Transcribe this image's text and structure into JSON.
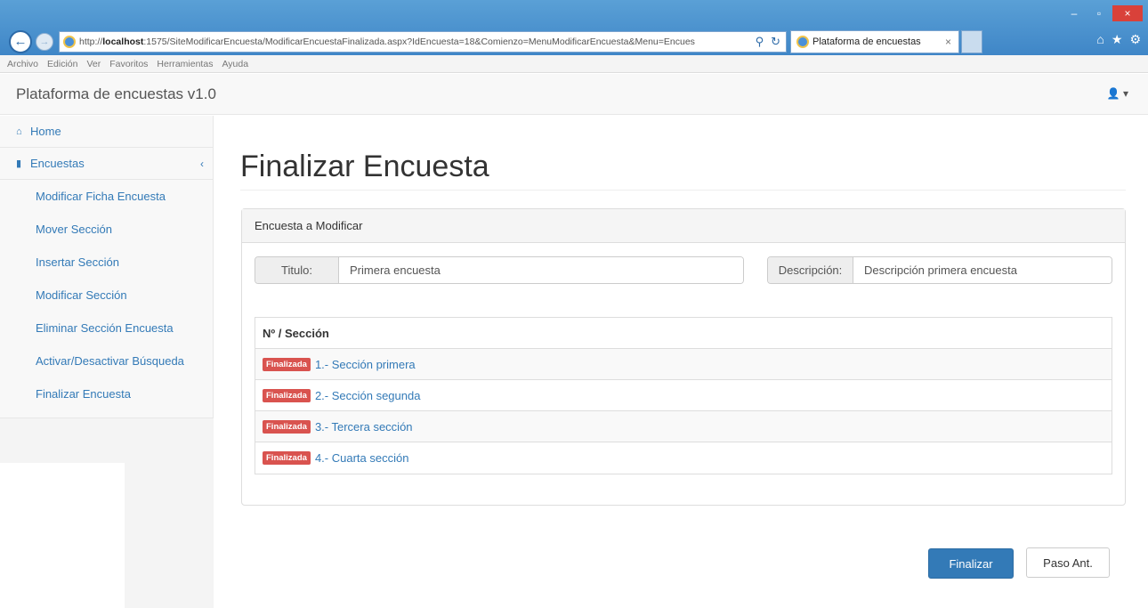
{
  "browser": {
    "url_prefix": "http://",
    "url_host": "localhost",
    "url_rest": ":1575/SiteModificarEncuesta/ModificarEncuestaFinalizada.aspx?IdEncuesta=18&Comienzo=MenuModificarEncuesta&Menu=Encues",
    "search_glyph": "⚲",
    "refresh_glyph": "↻",
    "tab_title": "Plataforma de encuestas",
    "tab_close": "×",
    "window_minimize": "–",
    "window_maximize": "▫",
    "window_close": "×",
    "home_glyph": "⌂",
    "star_glyph": "★",
    "gear_glyph": "⚙",
    "back_glyph": "←",
    "forward_glyph": "→",
    "menu": [
      "Archivo",
      "Edición",
      "Ver",
      "Favoritos",
      "Herramientas",
      "Ayuda"
    ]
  },
  "navbar": {
    "brand": "Plataforma de encuestas v1.0",
    "user_glyph": "👤 ▾"
  },
  "sidebar": {
    "home": "Home",
    "home_glyph": "⌂",
    "encuestas": "Encuestas",
    "encuestas_glyph": "▮",
    "chevron": "‹",
    "items": [
      "Modificar Ficha Encuesta",
      "Mover Sección",
      "Insertar Sección",
      "Modificar Sección",
      "Eliminar Sección Encuesta",
      "Activar/Desactivar Búsqueda",
      "Finalizar Encuesta"
    ]
  },
  "main": {
    "title": "Finalizar Encuesta",
    "panel_heading": "Encuesta a Modificar",
    "titulo_label": "Titulo:",
    "titulo_value": "Primera encuesta",
    "desc_label": "Descripción:",
    "desc_value": "Descripción primera encuesta",
    "table_header": "Nº / Sección",
    "sections": [
      {
        "badge": "Finalizada",
        "text": "1.- Sección primera"
      },
      {
        "badge": "Finalizada",
        "text": "2.- Sección segunda"
      },
      {
        "badge": "Finalizada",
        "text": "3.- Tercera sección"
      },
      {
        "badge": "Finalizada",
        "text": "4.- Cuarta sección"
      }
    ],
    "btn_finalizar": "Finalizar",
    "btn_paso_ant": "Paso Ant."
  },
  "colors": {
    "primary": "#337ab7",
    "danger": "#d9534f",
    "browser_chrome": "#4a91d0"
  }
}
